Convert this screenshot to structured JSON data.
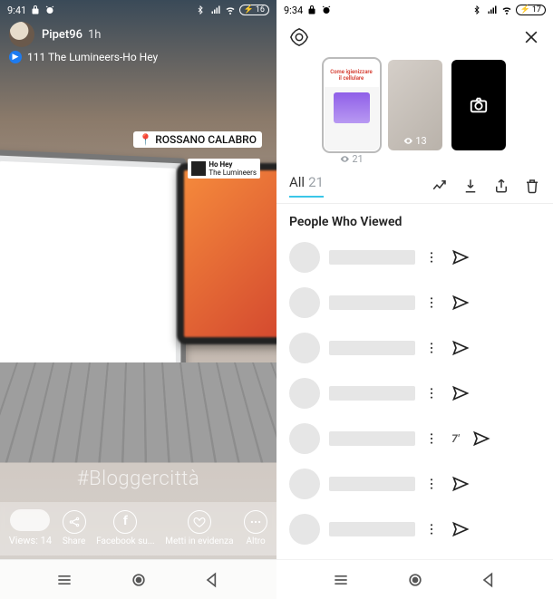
{
  "left": {
    "status": {
      "time": "9:41",
      "battery": "16"
    },
    "story": {
      "username": "Pipet96",
      "time_ago": "1h",
      "music_label": "111 The Lumineers-Ho Hey",
      "location": "ROSSANO CALABRO",
      "music_chip_title": "Ho Hey",
      "music_chip_artist": "The Lumineers",
      "hashtag": "#Bloggercittà"
    },
    "footer": {
      "views_label": "Views:",
      "views_count": "14",
      "share_label": "Share",
      "facebook_label": "Facebook su...",
      "highlight_label": "Metti in evidenza",
      "more_label": "Altro"
    }
  },
  "right": {
    "status": {
      "time": "9:34",
      "battery": "17"
    },
    "thumbs": {
      "active_caption": "Come igienizzare il cellulare",
      "active_views": "21",
      "second_views": "13"
    },
    "tabs": {
      "all_label": "All",
      "all_count": "21"
    },
    "section_title": "People Who Viewed",
    "viewer_count": 7,
    "special_row_index": 4,
    "special_row_text": "7'"
  }
}
